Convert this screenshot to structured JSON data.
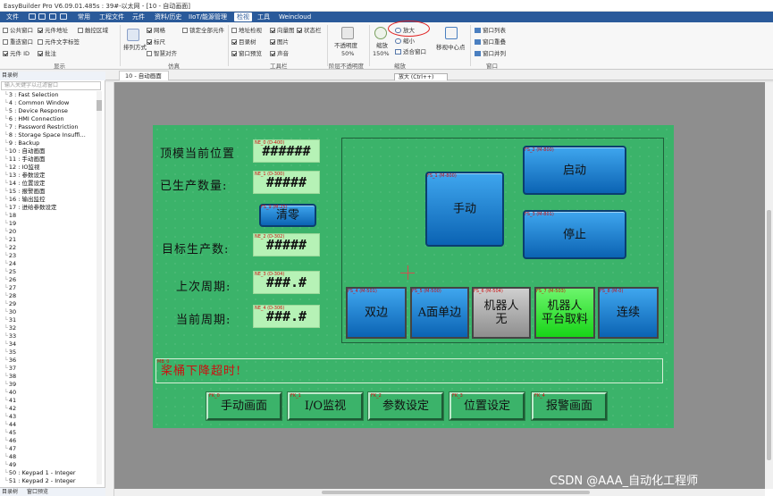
{
  "window": {
    "title": "EasyBuilder Pro V6.09.01.485s : 39#-以太网 - [10 - 自动画面]"
  },
  "menu": {
    "items": [
      "文件",
      "常用",
      "工程文件",
      "元件",
      "资料/历史",
      "IIoT/能源管理",
      "检视",
      "工具",
      "Weincloud"
    ],
    "active": "检视"
  },
  "ribbon": {
    "display_group": {
      "checks": [
        {
          "label": "公共窗口",
          "checked": false
        },
        {
          "label": "元件地址",
          "checked": true
        },
        {
          "label": "触控区域",
          "checked": false
        },
        {
          "label": "重迭窗口",
          "checked": false
        },
        {
          "label": "元件文字标签",
          "checked": false
        },
        {
          "label": "元件 ID",
          "checked": true
        },
        {
          "label": "批注",
          "checked": true
        }
      ],
      "label": "显示"
    },
    "align_label": "排列方式",
    "grid_group": {
      "checks": [
        {
          "label": "网格",
          "checked": true
        },
        {
          "label": "标尺",
          "checked": true
        },
        {
          "label": "智慧对齐",
          "checked": false
        },
        {
          "label": "锁定全部元件",
          "checked": false
        }
      ],
      "label": "仿真"
    },
    "toolbar_group": {
      "checks": [
        {
          "label": "地址检视",
          "checked": false
        },
        {
          "label": "向量图",
          "checked": true
        },
        {
          "label": "状态栏",
          "checked": true
        },
        {
          "label": "目录树",
          "checked": true
        },
        {
          "label": "图片",
          "checked": true
        },
        {
          "label": "窗口预览",
          "checked": true
        },
        {
          "label": "声音",
          "checked": true
        }
      ],
      "label": "工具栏"
    },
    "opacity": {
      "label": "不透明度",
      "value": "50%",
      "group_label": "阶层不透明度"
    },
    "zoom": {
      "label": "缩放",
      "value": "150%",
      "zoom_in": "放大",
      "zoom_out": "缩小",
      "fit": "适合窗口",
      "group_label": "缩放"
    },
    "center": {
      "label": "移视中心点"
    },
    "window_group": {
      "items": [
        "窗口列表",
        "窗口重叠",
        "窗口并列"
      ],
      "label": "窗口"
    }
  },
  "tooltip": {
    "text": "放大 (Ctrl++)"
  },
  "doc_tab": {
    "label": "10 - 自动画面"
  },
  "left_panel": {
    "header": "目录树",
    "search_placeholder": "输入关键字以过滤窗口",
    "items": [
      "3 : Fast Selection",
      "4 : Common Window",
      "5 : Device Response",
      "6 : HMI Connection",
      "7 : Password Restriction",
      "8 : Storage Space Insuffi...",
      "9 : Backup",
      "10 : 自动画面",
      "11 : 手动画面",
      "12 : IO监视",
      "13 : 参数设定",
      "14 : 位置设定",
      "15 : 报警画面",
      "16 : 输出监控",
      "17 : 进给参数设定",
      "18",
      "19",
      "20",
      "21",
      "22",
      "23",
      "24",
      "25",
      "26",
      "27",
      "28",
      "29",
      "30",
      "31",
      "32",
      "33",
      "34",
      "35",
      "36",
      "37",
      "38",
      "39",
      "40",
      "41",
      "42",
      "43",
      "44",
      "45",
      "46",
      "47",
      "48",
      "49",
      "50 : Keypad 1 - Integer",
      "51 : Keypad 2 - Integer"
    ],
    "bottom_tabs": [
      "目录树",
      "窗口预览"
    ]
  },
  "hmi": {
    "labels": {
      "pos": "顶模当前位置",
      "prod": "已生产数量:",
      "target": "目标生产数:",
      "last_cycle": "上次周期:",
      "cur_cycle": "当前周期:"
    },
    "fields": {
      "pos": "######",
      "prod": "#####",
      "target": "#####",
      "last_cycle": "###.#",
      "cur_cycle": "###.#"
    },
    "tags": {
      "pos": "NE_0 (D-400)",
      "prod": "NE_1 (D-300)",
      "clear": "FS_9 (M-25)",
      "target": "NE_2 (D-302)",
      "last_cycle": "NE_3 (D-304)",
      "cur_cycle": "NE_4 (D-306)",
      "manual": "FS_1 (M-800)",
      "start": "FS_2 (M-800)",
      "stop": "FS_3 (M-801)",
      "double": "FS_4 (M-501)",
      "single": "FS_5 (M-500)",
      "robot_none": "FS_6 (M-504)",
      "robot_platform": "FS_7 (M-503)",
      "continuous": "FS_8 (M-0)",
      "alarm": "MB_0",
      "nav1": "FK_0",
      "nav2": "FK_1",
      "nav3": "FK_2",
      "nav4": "FK_3",
      "nav5": "FK_4"
    },
    "buttons": {
      "clear": "清零",
      "manual": "手动",
      "start": "启动",
      "stop": "停止",
      "double": "双边",
      "single": "A面单边",
      "robot_none": "机器人\n无",
      "robot_platform": "机器人\n平台取料",
      "continuous": "连续"
    },
    "alarm_text": "桨桶下降超时!",
    "nav": [
      "手动画面",
      "I/O监视",
      "参数设定",
      "位置设定",
      "报警画面"
    ]
  },
  "watermark": "CSDN @AAA_自动化工程师",
  "colors": {
    "menu_bg": "#2a5a9a",
    "hmi_bg": "#3bb36a",
    "button_blue": "#1a7fd0",
    "button_gray": "#a8a8a8",
    "button_green": "#33ee33",
    "alarm_red": "#cc1010",
    "highlight_circle": "#e02020"
  }
}
